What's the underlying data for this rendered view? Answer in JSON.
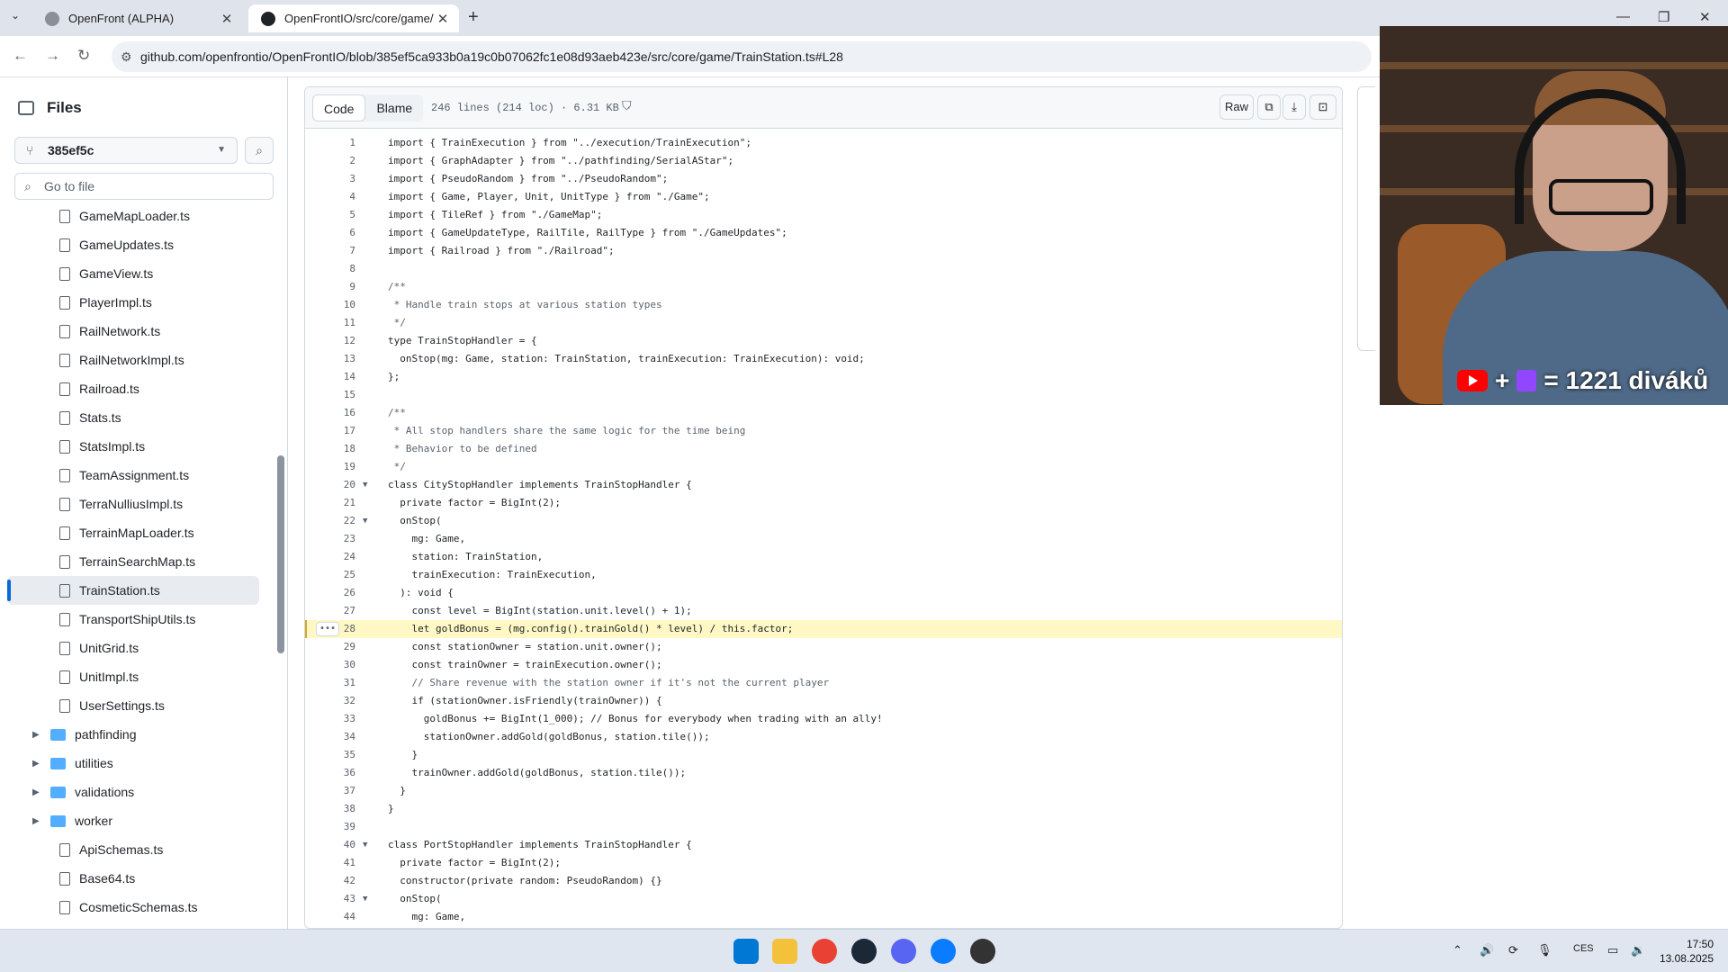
{
  "browser": {
    "tabs": [
      {
        "title": "OpenFront (ALPHA)",
        "active": false
      },
      {
        "title": "OpenFrontIO/src/core/game/Tr",
        "active": true
      }
    ],
    "url": "github.com/openfrontio/OpenFrontIO/blob/385ef5ca933b0a19c0b07062fc1e08d93aeb423e/src/core/game/TrainStation.ts#L28"
  },
  "sidebar": {
    "title": "Files",
    "branch": "385ef5c",
    "search_placeholder": "Go to file",
    "items": [
      {
        "type": "file",
        "label": "GameMapLoader.ts"
      },
      {
        "type": "file",
        "label": "GameUpdates.ts"
      },
      {
        "type": "file",
        "label": "GameView.ts"
      },
      {
        "type": "file",
        "label": "PlayerImpl.ts"
      },
      {
        "type": "file",
        "label": "RailNetwork.ts"
      },
      {
        "type": "file",
        "label": "RailNetworkImpl.ts"
      },
      {
        "type": "file",
        "label": "Railroad.ts"
      },
      {
        "type": "file",
        "label": "Stats.ts"
      },
      {
        "type": "file",
        "label": "StatsImpl.ts"
      },
      {
        "type": "file",
        "label": "TeamAssignment.ts"
      },
      {
        "type": "file",
        "label": "TerraNulliusImpl.ts"
      },
      {
        "type": "file",
        "label": "TerrainMapLoader.ts"
      },
      {
        "type": "file",
        "label": "TerrainSearchMap.ts"
      },
      {
        "type": "file",
        "label": "TrainStation.ts",
        "active": true
      },
      {
        "type": "file",
        "label": "TransportShipUtils.ts"
      },
      {
        "type": "file",
        "label": "UnitGrid.ts"
      },
      {
        "type": "file",
        "label": "UnitImpl.ts"
      },
      {
        "type": "file",
        "label": "UserSettings.ts"
      },
      {
        "type": "folder",
        "label": "pathfinding"
      },
      {
        "type": "folder",
        "label": "utilities"
      },
      {
        "type": "folder",
        "label": "validations"
      },
      {
        "type": "folder",
        "label": "worker"
      },
      {
        "type": "file",
        "label": "ApiSchemas.ts"
      },
      {
        "type": "file",
        "label": "Base64.ts"
      },
      {
        "type": "file",
        "label": "CosmeticSchemas.ts"
      }
    ]
  },
  "file_header": {
    "tab_code": "Code",
    "tab_blame": "Blame",
    "info": "246 lines (214 loc) · 6.31 KB ·",
    "raw_label": "Raw"
  },
  "code": {
    "highlighted_line": 28,
    "lines": [
      "import { TrainExecution } from \"../execution/TrainExecution\";",
      "import { GraphAdapter } from \"../pathfinding/SerialAStar\";",
      "import { PseudoRandom } from \"../PseudoRandom\";",
      "import { Game, Player, Unit, UnitType } from \"./Game\";",
      "import { TileRef } from \"./GameMap\";",
      "import { GameUpdateType, RailTile, RailType } from \"./GameUpdates\";",
      "import { Railroad } from \"./Railroad\";",
      "",
      "/**",
      " * Handle train stops at various station types",
      " */",
      "type TrainStopHandler = {",
      "  onStop(mg: Game, station: TrainStation, trainExecution: TrainExecution): void;",
      "};",
      "",
      "/**",
      " * All stop handlers share the same logic for the time being",
      " * Behavior to be defined",
      " */",
      "class CityStopHandler implements TrainStopHandler {",
      "  private factor = BigInt(2);",
      "  onStop(",
      "    mg: Game,",
      "    station: TrainStation,",
      "    trainExecution: TrainExecution,",
      "  ): void {",
      "    const level = BigInt(station.unit.level() + 1);",
      "    let goldBonus = (mg.config().trainGold() * level) / this.factor;",
      "    const stationOwner = station.unit.owner();",
      "    const trainOwner = trainExecution.owner();",
      "    // Share revenue with the station owner if it's not the current player",
      "    if (stationOwner.isFriendly(trainOwner)) {",
      "      goldBonus += BigInt(1_000); // Bonus for everybody when trading with an ally!",
      "      stationOwner.addGold(goldBonus, station.tile());",
      "    }",
      "    trainOwner.addGold(goldBonus, station.tile());",
      "  }",
      "}",
      "",
      "class PortStopHandler implements TrainStopHandler {",
      "  private factor = BigInt(2);",
      "  constructor(private random: PseudoRandom) {}",
      "  onStop(",
      "    mg: Game,"
    ],
    "folds": [
      20,
      22,
      40,
      43
    ]
  },
  "stream_overlay": {
    "viewer_text": "= 1221 diváků"
  },
  "taskbar": {
    "language": "CES",
    "time": "17:50",
    "date": "13.08.2025"
  }
}
